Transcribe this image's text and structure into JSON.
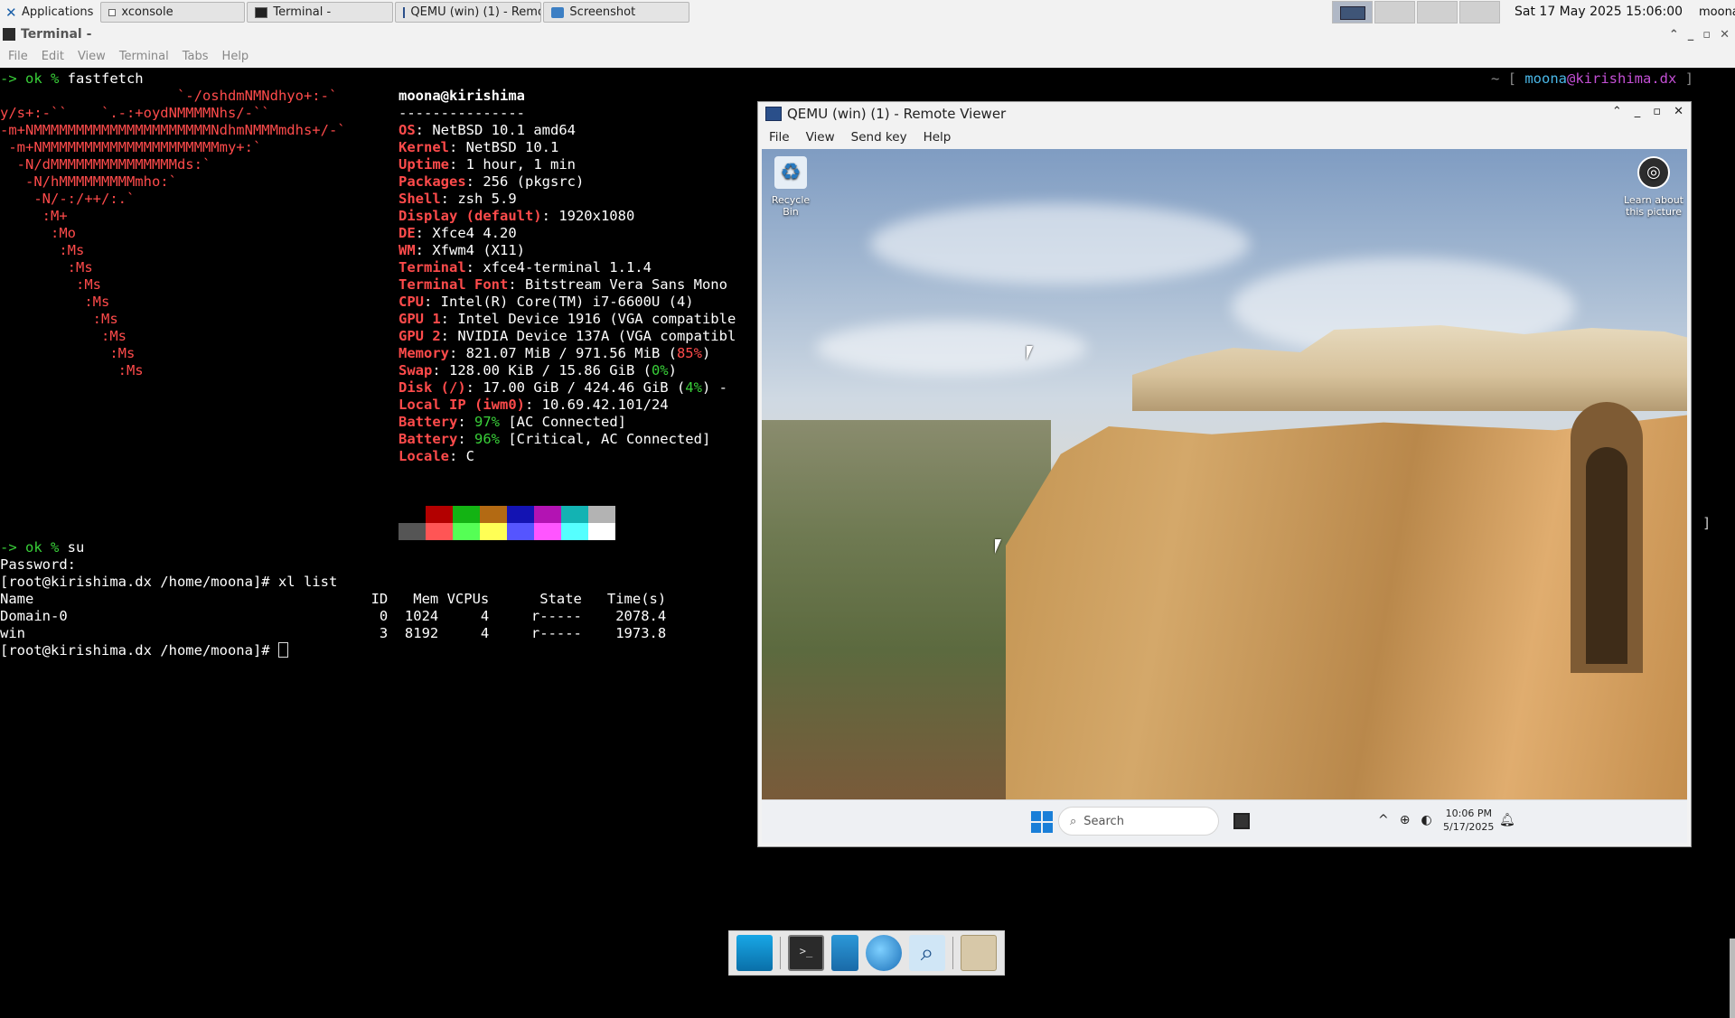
{
  "top_panel": {
    "applications_label": "Applications",
    "tasks": [
      {
        "label": "xconsole"
      },
      {
        "label": "Terminal -"
      },
      {
        "label": "QEMU (win) (1) - Remote ..."
      },
      {
        "label": "Screenshot"
      }
    ],
    "clock": "Sat 17 May 2025 15:06:00",
    "user": "moona"
  },
  "terminal": {
    "title": "Terminal -",
    "menu": [
      "File",
      "Edit",
      "View",
      "Terminal",
      "Tabs",
      "Help"
    ],
    "right_prompt": {
      "open": "~ [",
      "user": "moona",
      "at": "@",
      "host": "kirishima.dx",
      "close": "]"
    },
    "first_command": {
      "prompt": "-> ok % ",
      "cmd": "fastfetch"
    },
    "ascii_logo": [
      "                     `-/oshdmNMNdhyo+:-`",
      "y/s+:-``    `.-:+oydNMMMMNhs/-``",
      "-m+NMMMMMMMMMMMMMMMMMMMMMNdhmNMMMmdhs+/-`",
      " -m+NMMMMMMMMMMMMMMMMMMMMMmy+:`",
      "  -N/dMMMMMMMMMMMMMMMds:`",
      "   -N/hMMMMMMMMMmho:`",
      "    -N/-:/++/:.`",
      "     :M+",
      "      :Mo",
      "       :Ms",
      "        :Ms",
      "         :Ms",
      "          :Ms",
      "           :Ms",
      "            :Ms",
      "             :Ms",
      "              :Ms"
    ],
    "userhost": "moona@kirishima",
    "separator": "---------------",
    "info": [
      {
        "key": "OS",
        "sep": ": ",
        "value": "NetBSD 10.1 amd64"
      },
      {
        "key": "Kernel",
        "sep": ": ",
        "value": "NetBSD 10.1"
      },
      {
        "key": "Uptime",
        "sep": ": ",
        "value": "1 hour, 1 min"
      },
      {
        "key": "Packages",
        "sep": ": ",
        "value": "256 (pkgsrc)"
      },
      {
        "key": "Shell",
        "sep": ": ",
        "value": "zsh 5.9"
      },
      {
        "key": "Display (default)",
        "sep": ": ",
        "value": "1920x1080"
      },
      {
        "key": "DE",
        "sep": ": ",
        "value": "Xfce4 4.20"
      },
      {
        "key": "WM",
        "sep": ": ",
        "value": "Xfwm4 (X11)"
      },
      {
        "key": "Terminal",
        "sep": ": ",
        "value": "xfce4-terminal 1.1.4"
      },
      {
        "key": "Terminal Font",
        "sep": ": ",
        "value": "Bitstream Vera Sans Mono"
      },
      {
        "key": "CPU",
        "sep": ": ",
        "value": "Intel(R) Core(TM) i7-6600U (4)"
      },
      {
        "key": "GPU 1",
        "sep": ": ",
        "value": "Intel Device 1916 (VGA compatible"
      },
      {
        "key": "GPU 2",
        "sep": ": ",
        "value": "NVIDIA Device 137A (VGA compatibl"
      },
      {
        "key": "Memory",
        "sep": ": ",
        "value": "821.07 MiB / 971.56 MiB (",
        "pct": "85%",
        "pct_color": "red",
        "tail": ")"
      },
      {
        "key": "Swap",
        "sep": ": ",
        "value": "128.00 KiB / 15.86 GiB (",
        "pct": "0%",
        "pct_color": "green",
        "tail": ")"
      },
      {
        "key": "Disk (/)",
        "sep": ": ",
        "value": "17.00 GiB / 424.46 GiB (",
        "pct": "4%",
        "pct_color": "green",
        "tail": ") -"
      },
      {
        "key": "Local IP (iwm0)",
        "sep": ": ",
        "value": "10.69.42.101/24"
      },
      {
        "key": "Battery",
        "sep": ": ",
        "value": "",
        "pct": "97%",
        "pct_color": "green",
        "tail": " [AC Connected]"
      },
      {
        "key": "Battery",
        "sep": ": ",
        "value": "",
        "pct": "96%",
        "pct_color": "green",
        "tail": " [Critical, AC Connected]"
      },
      {
        "key": "Locale",
        "sep": ": ",
        "value": "C"
      }
    ],
    "palette_colors": [
      "#000000",
      "#b30000",
      "#13b313",
      "#b36a13",
      "#1313b3",
      "#b313b3",
      "#13b3b3",
      "#b3b3b3",
      "#555555",
      "#ff5555",
      "#55ff55",
      "#ffff55",
      "#5555ff",
      "#ff55ff",
      "#55ffff",
      "#ffffff"
    ],
    "second_command": {
      "prompt": "-> ok % ",
      "cmd": "su"
    },
    "password_line": "Password:",
    "root_prompt": "[root@kirishima.dx /home/moona]# ",
    "xl_cmd": "xl list",
    "xl_header": "Name                                        ID   Mem VCPUs      State   Time(s)",
    "xl_rows": [
      "Domain-0                                     0  1024     4     r-----    2078.4",
      "win                                          3  8192     4     r-----    1973.8"
    ]
  },
  "qemu": {
    "title": "QEMU (win) (1) - Remote Viewer",
    "menu": [
      "File",
      "View",
      "Send key",
      "Help"
    ],
    "desktop_icons": {
      "recycle_bin": "Recycle Bin",
      "learn_line1": "Learn about",
      "learn_line2": "this picture"
    },
    "taskbar": {
      "search_placeholder": "Search",
      "time": "10:06 PM",
      "date": "5/17/2025"
    }
  },
  "icons": {
    "app_menu": "xfce-mouse-icon",
    "dock": [
      "show-desktop-icon",
      "terminal-icon",
      "file-manager-icon",
      "web-browser-icon",
      "app-finder-icon",
      "folder-icon"
    ]
  }
}
